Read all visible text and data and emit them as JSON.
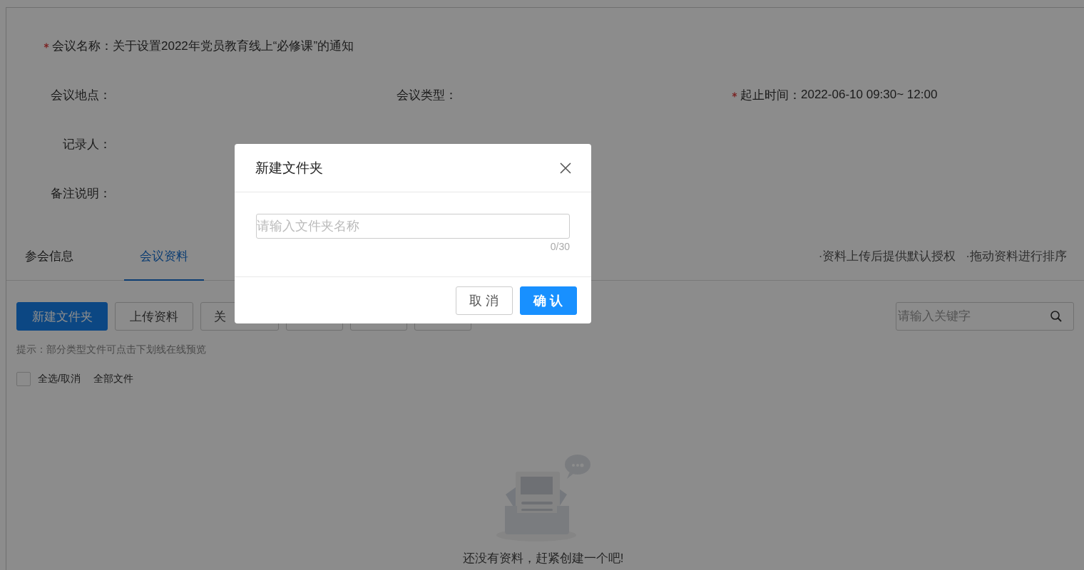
{
  "meeting": {
    "name": {
      "label": "会议名称：",
      "value": "关于设置2022年党员教育线上“必修课”的通知",
      "required": true
    },
    "field_rows": [
      [
        {
          "label": "会议地点：",
          "required": false
        },
        {
          "label": "会议类型：",
          "required": false
        },
        {
          "label": "起止时间：",
          "value": "2022-06-10 09:30~ 12:00",
          "required": true
        }
      ],
      [
        {
          "label": "记录人：",
          "required": false
        }
      ],
      [
        {
          "label": "备注说明：",
          "required": false
        }
      ]
    ]
  },
  "tabs": [
    {
      "label": "参会信息",
      "selected": false
    },
    {
      "label": "会议资料",
      "selected": true
    }
  ],
  "tips": [
    "·资料上传后提供默认授权",
    "·拖动资料进行排序"
  ],
  "toolbar": [
    {
      "label": "新建文件夹",
      "kind": "primary"
    },
    {
      "label": "上传资料",
      "kind": "default"
    },
    {
      "label": "关",
      "kind": "default"
    },
    {
      "kind": "default"
    },
    {
      "kind": "default"
    },
    {
      "kind": "default"
    }
  ],
  "search": {
    "placeholder": "请输入关键字"
  },
  "hint": "提示：部分类型文件可点击下划线在线预览",
  "select_all": {
    "label": "全选/取消",
    "checked": false
  },
  "breadcrumb": "全部文件",
  "empty_text": "还没有资料，赶紧创建一个吧!",
  "dialog": {
    "title": "新建文件夹",
    "placeholder": "请输入文件夹名称",
    "counter": "0/30",
    "buttons": [
      {
        "label": "取 消",
        "kind": "default"
      },
      {
        "label": "确 认",
        "kind": "primary"
      }
    ]
  }
}
